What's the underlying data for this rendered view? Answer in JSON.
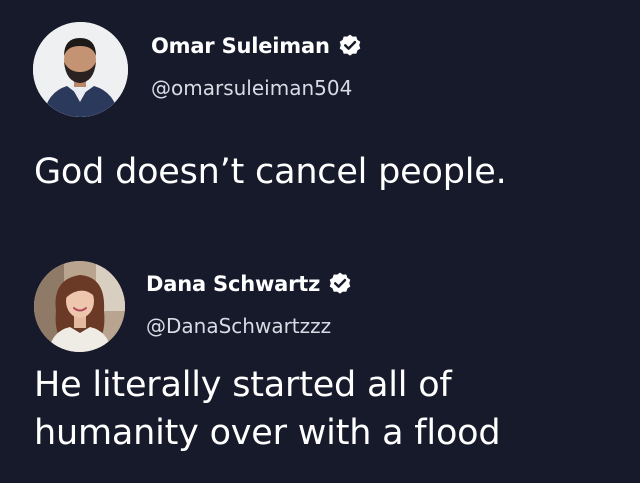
{
  "tweets": [
    {
      "display_name": "Omar Suleiman",
      "handle": "@omarsuleiman504",
      "verified": true,
      "text": "God doesn’t cancel people."
    },
    {
      "display_name": "Dana Schwartz",
      "handle": "@DanaSchwartzzz",
      "verified": true,
      "text_lines": [
        "He literally started all of",
        "humanity over with a flood"
      ]
    }
  ],
  "colors": {
    "background": "#171a2b",
    "text": "#ffffff",
    "handle": "#d8dae4",
    "verified_badge": "#ffffff"
  },
  "icons": [
    "verified-badge-icon",
    "avatar-photo"
  ]
}
